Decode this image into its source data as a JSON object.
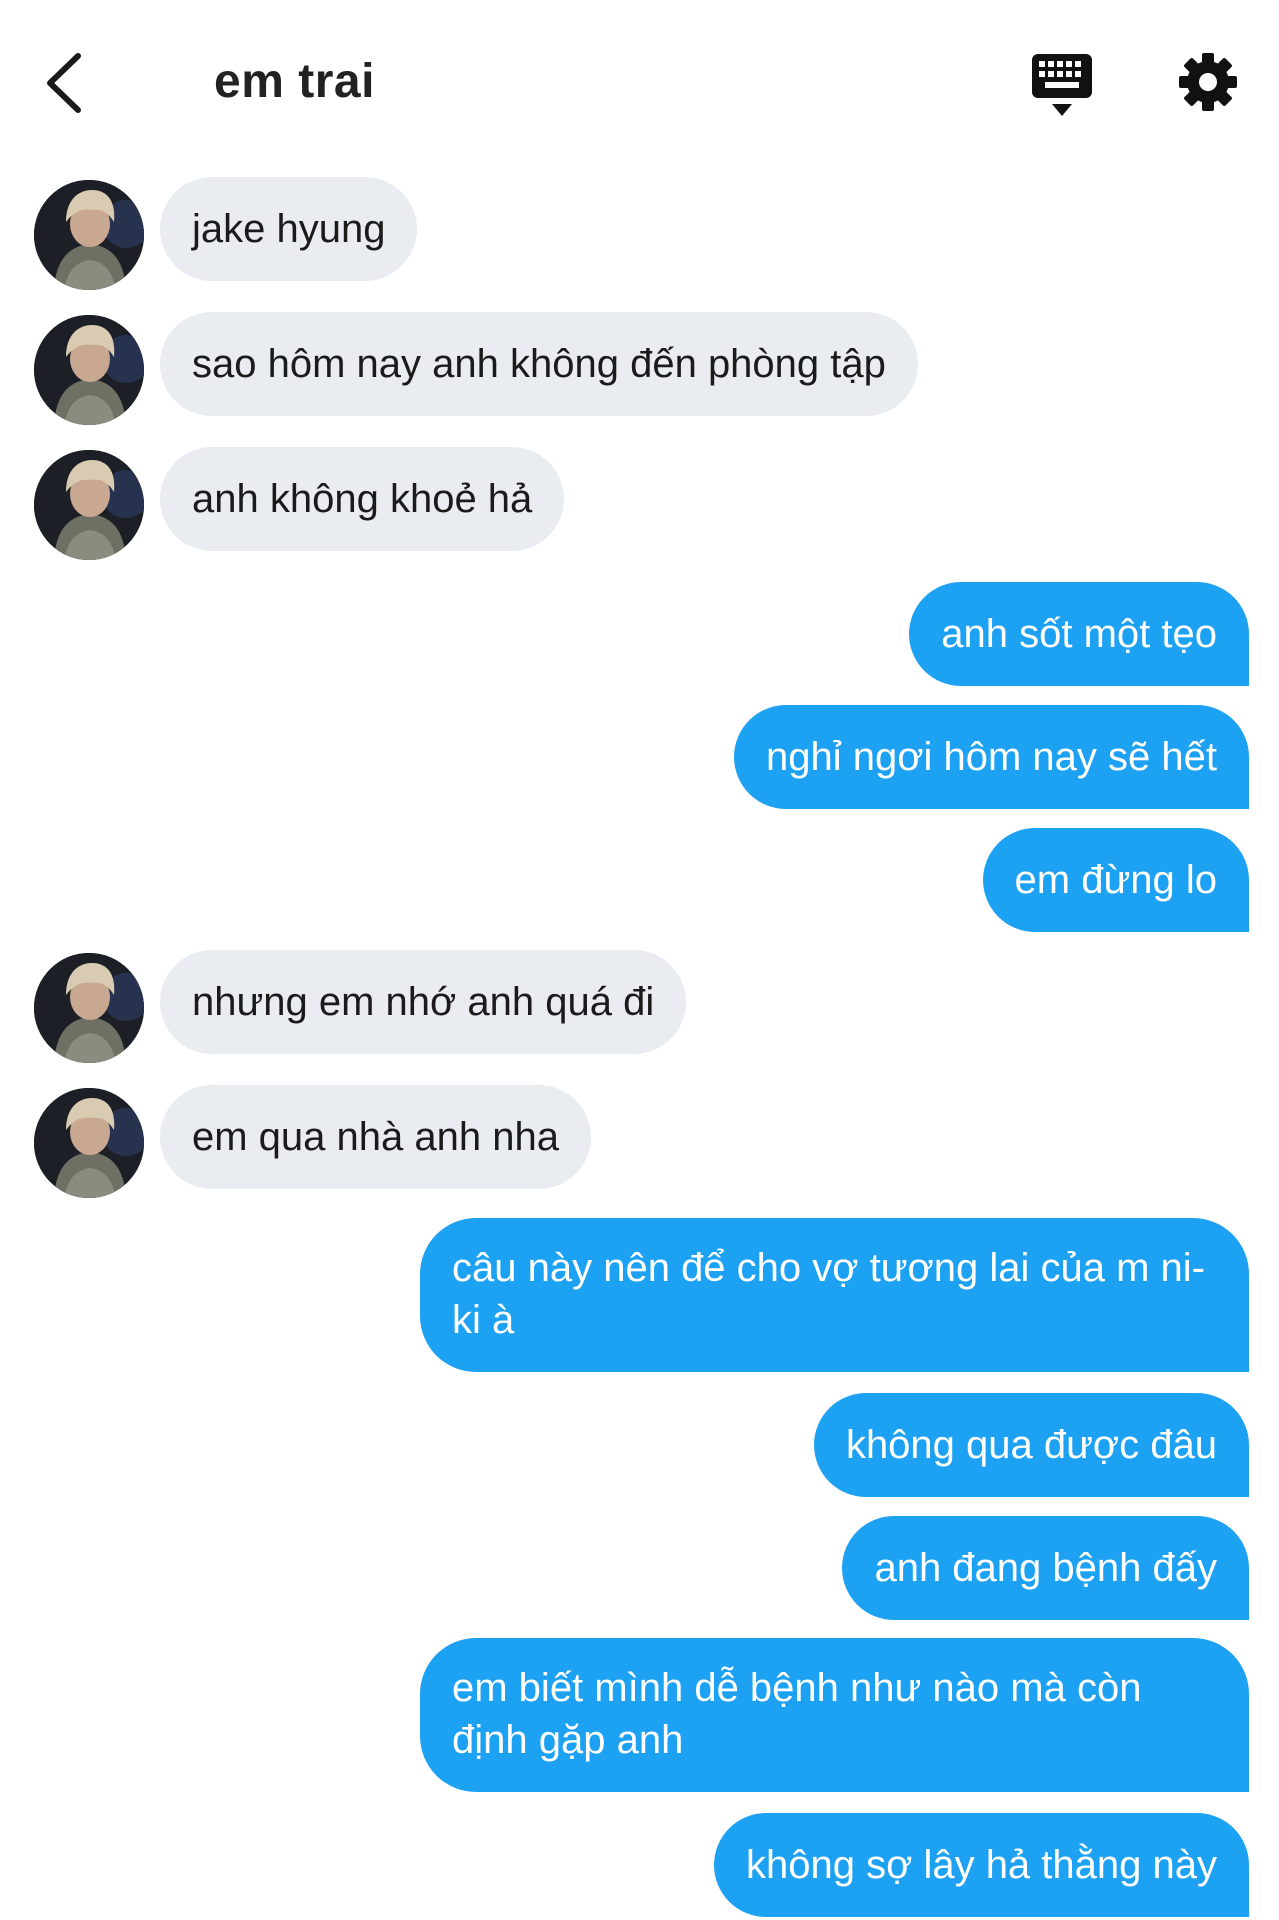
{
  "header": {
    "title": "em trai",
    "back_icon": "chevron-left-icon",
    "keyboard_icon": "keyboard-icon",
    "settings_icon": "gear-icon"
  },
  "colors": {
    "incoming_bubble": "#e9ecf0",
    "outgoing_bubble": "#1da1f2",
    "outgoing_text": "#ffffff"
  },
  "messages": [
    {
      "direction": "in",
      "text": "jake hyung"
    },
    {
      "direction": "in",
      "text": "sao hôm nay anh không đến phòng tập"
    },
    {
      "direction": "in",
      "text": "anh không khoẻ hả"
    },
    {
      "direction": "out",
      "text": "anh sốt một tẹo"
    },
    {
      "direction": "out",
      "text": "nghỉ ngơi hôm nay sẽ hết"
    },
    {
      "direction": "out",
      "text": "em đừng lo"
    },
    {
      "direction": "in",
      "text": "nhưng em nhớ anh quá đi"
    },
    {
      "direction": "in",
      "text": "em qua nhà anh nha"
    },
    {
      "direction": "out",
      "text": "câu này nên để cho vợ tương lai của m ni-ki à"
    },
    {
      "direction": "out",
      "text": "không qua được đâu"
    },
    {
      "direction": "out",
      "text": "anh đang bệnh đấy"
    },
    {
      "direction": "out",
      "text": "em biết mình dễ bệnh như nào mà còn định gặp anh"
    },
    {
      "direction": "out",
      "text": "không sợ lây hả thằng này"
    }
  ]
}
